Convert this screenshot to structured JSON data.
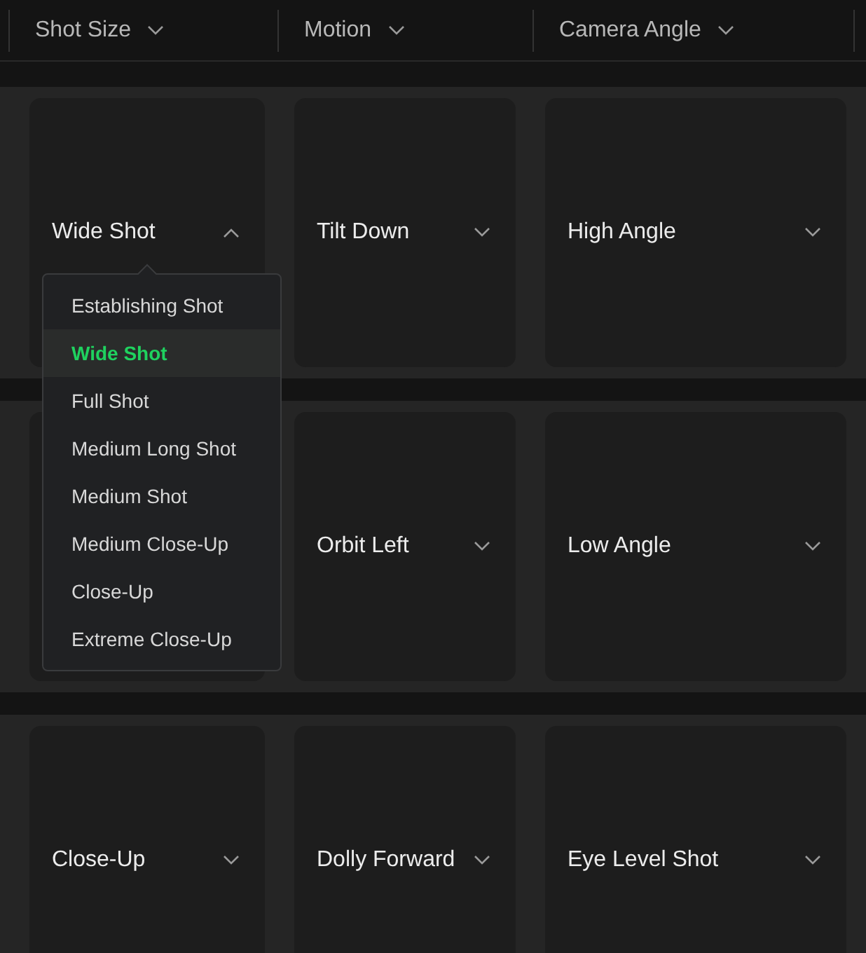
{
  "header": {
    "filters": [
      {
        "label": "Shot Size"
      },
      {
        "label": "Motion"
      },
      {
        "label": "Camera Angle"
      }
    ]
  },
  "rows": [
    {
      "cells": [
        {
          "label": "Wide Shot",
          "expanded": true,
          "menu": [
            {
              "label": "Establishing Shot",
              "selected": false
            },
            {
              "label": "Wide Shot",
              "selected": true
            },
            {
              "label": "Full Shot",
              "selected": false
            },
            {
              "label": "Medium Long Shot",
              "selected": false
            },
            {
              "label": "Medium Shot",
              "selected": false
            },
            {
              "label": "Medium Close-Up",
              "selected": false
            },
            {
              "label": "Close-Up",
              "selected": false
            },
            {
              "label": "Extreme Close-Up",
              "selected": false
            }
          ]
        },
        {
          "label": "Tilt Down",
          "expanded": false
        },
        {
          "label": "High Angle",
          "expanded": false
        }
      ]
    },
    {
      "cells": [
        {},
        {
          "label": "Orbit Left",
          "expanded": false
        },
        {
          "label": "Low Angle",
          "expanded": false
        }
      ]
    },
    {
      "cells": [
        {
          "label": "Close-Up",
          "expanded": false
        },
        {
          "label": "Dolly Forward",
          "expanded": false
        },
        {
          "label": "Eye Level Shot",
          "expanded": false
        }
      ]
    }
  ]
}
